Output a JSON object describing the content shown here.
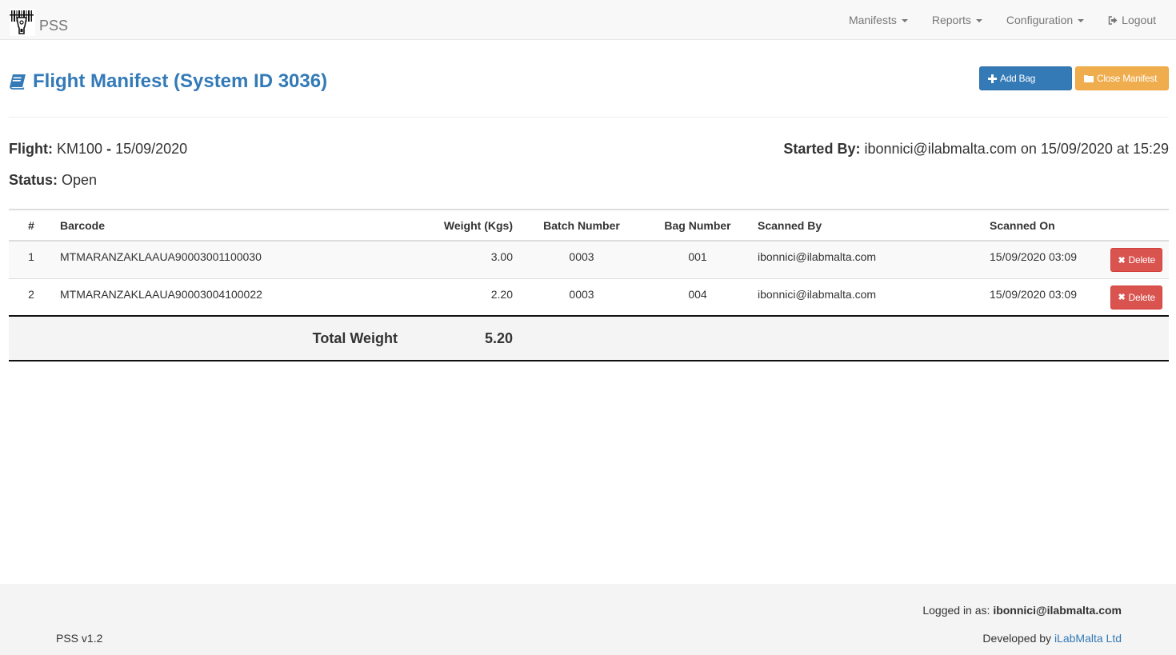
{
  "navbar": {
    "brand": "PSS",
    "logo_icon": "barcode-scanner-icon",
    "items": [
      {
        "label": "Manifests",
        "dropdown": true
      },
      {
        "label": "Reports",
        "dropdown": true
      },
      {
        "label": "Configuration",
        "dropdown": true
      },
      {
        "label": "Logout",
        "icon": "sign-out-icon"
      }
    ]
  },
  "header": {
    "title": "Flight Manifest (System ID 3036)",
    "title_icon": "book-icon",
    "add_bag_label": "Add Bag",
    "close_manifest_label": "Close Manifest"
  },
  "info": {
    "flight_label": "Flight:",
    "flight_value": "KM100",
    "flight_separator": "-",
    "flight_date": "15/09/2020",
    "status_label": "Status:",
    "status_value": "Open",
    "started_label": "Started By:",
    "started_value": "ibonnici@ilabmalta.com on 15/09/2020 at 15:29"
  },
  "table": {
    "columns": [
      "#",
      "Barcode",
      "Weight (Kgs)",
      "Batch Number",
      "Bag Number",
      "Scanned By",
      "Scanned On",
      ""
    ],
    "rows": [
      {
        "num": "1",
        "barcode": "MTMARANZAKLAAUA90003001100030",
        "weight": "3.00",
        "batch": "0003",
        "bag": "001",
        "scanned_by": "ibonnici@ilabmalta.com",
        "scanned_on": "15/09/2020 03:09",
        "action": "Delete"
      },
      {
        "num": "2",
        "barcode": "MTMARANZAKLAAUA90003004100022",
        "weight": "2.20",
        "batch": "0003",
        "bag": "004",
        "scanned_by": "ibonnici@ilabmalta.com",
        "scanned_on": "15/09/2020 03:09",
        "action": "Delete"
      }
    ],
    "total_label": "Total Weight",
    "total_value": "5.20"
  },
  "footer": {
    "version": "PSS v1.2",
    "logged_in_label": "Logged in as:",
    "logged_in_user": "ibonnici@ilabmalta.com",
    "developed_label": "Developed by",
    "developer_link": "iLabMalta Ltd"
  },
  "colors": {
    "primary": "#337ab7",
    "warning": "#f0ad4e",
    "danger": "#d9534f"
  }
}
